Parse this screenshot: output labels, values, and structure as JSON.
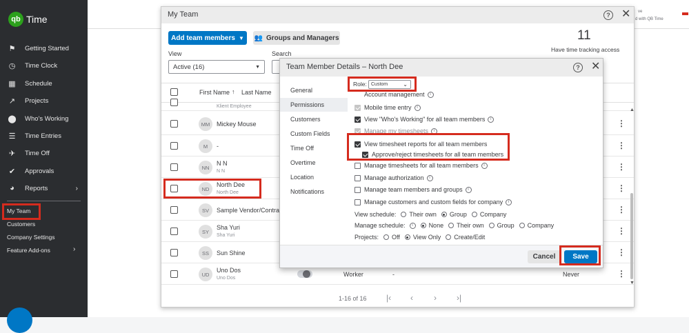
{
  "app": {
    "brand": "Time",
    "logo_text": "qb"
  },
  "sidebar": {
    "items": [
      {
        "label": "Getting Started",
        "icon": "flag-icon"
      },
      {
        "label": "Time Clock",
        "icon": "clock-icon"
      },
      {
        "label": "Schedule",
        "icon": "calendar-icon"
      },
      {
        "label": "Projects",
        "icon": "chart-line-icon"
      },
      {
        "label": "Who's Working",
        "icon": "location-pin-icon"
      },
      {
        "label": "Time Entries",
        "icon": "list-icon"
      },
      {
        "label": "Time Off",
        "icon": "plane-icon"
      },
      {
        "label": "Approvals",
        "icon": "checkmark-icon"
      },
      {
        "label": "Reports",
        "icon": "pie-chart-icon"
      }
    ],
    "subitems": [
      "My Team",
      "Customers",
      "Company Settings",
      "Feature Add-ons"
    ]
  },
  "background_note": {
    "line1": "ve",
    "line2": "d with QB Time"
  },
  "my_team": {
    "title": "My Team",
    "add_button": "Add team members",
    "groups_button": "Groups and Managers",
    "count": "11",
    "count_caption": "Have time tracking access",
    "view_label": "View",
    "view_value": "Active (16)",
    "search_label": "Search",
    "columns": {
      "first_name": "First Name",
      "last_name": "Last Name"
    },
    "rows": [
      {
        "initials": "",
        "name": "",
        "sub": "Klient Employee"
      },
      {
        "initials": "MM",
        "name": "Mickey Mouse",
        "sub": ""
      },
      {
        "initials": "M",
        "name": "-",
        "sub": ""
      },
      {
        "initials": "NN",
        "name": "N N",
        "sub": "N N"
      },
      {
        "initials": "ND",
        "name": "North Dee",
        "sub": "North Dee"
      },
      {
        "initials": "SV",
        "name": "Sample Vendor/Contra",
        "sub": ""
      },
      {
        "initials": "SY",
        "name": "Sha Yuri",
        "sub": "Sha Yuri"
      },
      {
        "initials": "SS",
        "name": "Sun Shine",
        "sub": ""
      },
      {
        "initials": "UD",
        "name": "Uno Dos",
        "sub": "Uno Dos",
        "role": "Worker",
        "dash": "-",
        "last": "Never"
      }
    ],
    "pagination": "1-16 of 16"
  },
  "details": {
    "title": "Team Member Details – North Dee",
    "menu": [
      "General",
      "Permissions",
      "Customers",
      "Custom Fields",
      "Time Off",
      "Overtime",
      "Location",
      "Notifications"
    ],
    "role_label": "Role:",
    "role_value": "Custom",
    "permissions": [
      {
        "label": "Account management",
        "state": "off",
        "info": true
      },
      {
        "label": "Mobile time entry",
        "state": "dis",
        "info": true
      },
      {
        "label": "View \"Who's Working\" for all team members",
        "state": "on",
        "info": true
      },
      {
        "label": "Manage my timesheets",
        "state": "dis",
        "info": true
      },
      {
        "label": "View timesheet reports for all team members",
        "state": "on",
        "info": false
      },
      {
        "label": "Approve/reject timesheets for all team members",
        "state": "on",
        "info": false
      },
      {
        "label": "Manage timesheets for all team members",
        "state": "off",
        "info": true
      },
      {
        "label": "Manage authorization",
        "state": "off",
        "info": true
      },
      {
        "label": "Manage team members and groups",
        "state": "off",
        "info": true
      },
      {
        "label": "Manage customers and custom fields for company",
        "state": "off",
        "info": true
      }
    ],
    "view_schedule": {
      "label": "View schedule:",
      "options": [
        "Their own",
        "Group",
        "Company"
      ],
      "selected": "Group"
    },
    "manage_schedule": {
      "label": "Manage schedule:",
      "options": [
        "None",
        "Their own",
        "Group",
        "Company"
      ],
      "selected": "None"
    },
    "projects": {
      "label": "Projects:",
      "options": [
        "Off",
        "View Only",
        "Create/Edit"
      ],
      "selected": "View Only"
    },
    "cancel": "Cancel",
    "save": "Save"
  }
}
